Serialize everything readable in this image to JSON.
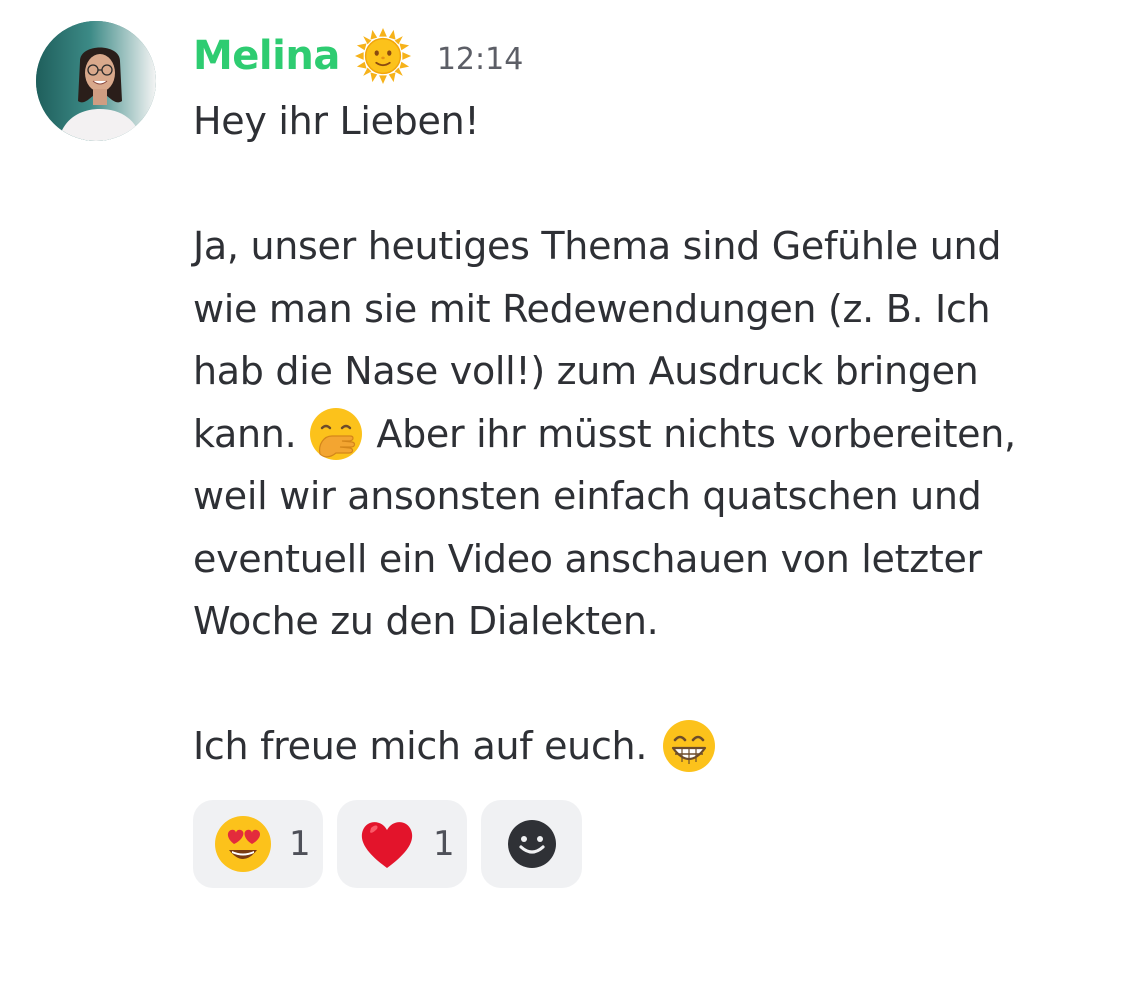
{
  "message": {
    "author": "Melina",
    "author_badge_icon": "sun-with-face-icon",
    "timestamp": "12:14",
    "colors": {
      "author": "#2ecc71",
      "text": "#2e3035",
      "timestamp": "#5c5e66",
      "reaction_bg": "#f0f1f3"
    },
    "lines": {
      "l1": "Hey ihr Lieben!",
      "l2": "Ja, unser heutiges Thema sind Gefühle und",
      "l3": "wie man sie mit Redewendungen (z. B. Ich",
      "l4": "hab die Nase voll!) zum Ausdruck bringen",
      "l5a": "kann.",
      "l5b": "Aber ihr müsst nichts vorbereiten,",
      "l6": "weil wir ansonsten einfach quatschen und",
      "l7": "eventuell ein Video anschauen von letzter",
      "l8": "Woche zu den Dialekten.",
      "l9": "Ich freue mich auf euch."
    },
    "inline_emojis": [
      "face-with-hand-over-mouth-icon",
      "grinning-face-with-smiling-eyes-icon"
    ]
  },
  "reactions": [
    {
      "emoji": "heart-eyes-icon",
      "count": "1"
    },
    {
      "emoji": "red-heart-icon",
      "count": "1"
    }
  ],
  "add_reaction_icon": "add-reaction-smiley-icon"
}
